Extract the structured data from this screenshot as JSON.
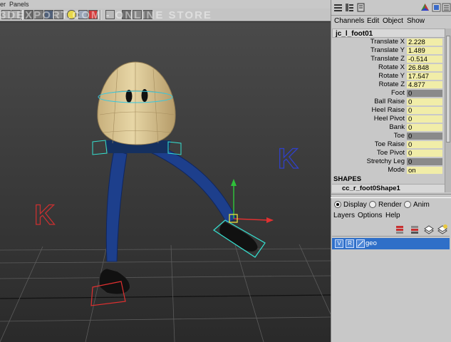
{
  "viewport": {
    "menu": [
      "Panels"
    ],
    "menu_partial": "er",
    "watermark": "3DEXPORT.COM - ONLINE STORE",
    "scene_marks": {
      "left_k": "K",
      "right_k": "K"
    }
  },
  "channel_box": {
    "menu": [
      "Channels",
      "Edit",
      "Object",
      "Show"
    ],
    "object_name": "jc_l_foot01",
    "attributes": [
      {
        "label": "Translate X",
        "value": "2.228",
        "keyed": false
      },
      {
        "label": "Translate Y",
        "value": "1.489",
        "keyed": false
      },
      {
        "label": "Translate Z",
        "value": "-0.514",
        "keyed": false
      },
      {
        "label": "Rotate X",
        "value": "26.848",
        "keyed": false
      },
      {
        "label": "Rotate Y",
        "value": "17.547",
        "keyed": false
      },
      {
        "label": "Rotate Z",
        "value": "4.877",
        "keyed": false
      },
      {
        "label": "Foot",
        "value": "0",
        "keyed": true
      },
      {
        "label": "Ball Raise",
        "value": "0",
        "keyed": false
      },
      {
        "label": "Heel Raise",
        "value": "0",
        "keyed": false
      },
      {
        "label": "Heel Pivot",
        "value": "0",
        "keyed": false
      },
      {
        "label": "Bank",
        "value": "0",
        "keyed": false
      },
      {
        "label": "Toe",
        "value": "0",
        "keyed": true
      },
      {
        "label": "Toe Raise",
        "value": "0",
        "keyed": false
      },
      {
        "label": "Toe Pivot",
        "value": "0",
        "keyed": false
      },
      {
        "label": "Stretchy Leg",
        "value": "0",
        "keyed": true
      },
      {
        "label": "Mode",
        "value": "on",
        "keyed": false
      }
    ],
    "shapes_header": "SHAPES",
    "shape_name": "cc_r_foot0Shape1"
  },
  "layer_editor": {
    "tabs": [
      {
        "label": "Display",
        "selected": true
      },
      {
        "label": "Render",
        "selected": false
      },
      {
        "label": "Anim",
        "selected": false
      }
    ],
    "menu": [
      "Layers",
      "Options",
      "Help"
    ],
    "layers": [
      {
        "visible": "V",
        "reference": "R",
        "name": "geo"
      }
    ]
  },
  "colors": {
    "selection": "#2f6fc8",
    "attr_field": "#f1eda8",
    "keyed_field": "#8a8a8a",
    "viewport_bg": "#2b2b2b",
    "ctrl_cyan": "#35e0d0",
    "ctrl_red": "#e03030",
    "k_blue": "#3040c8",
    "k_red": "#c83030"
  }
}
